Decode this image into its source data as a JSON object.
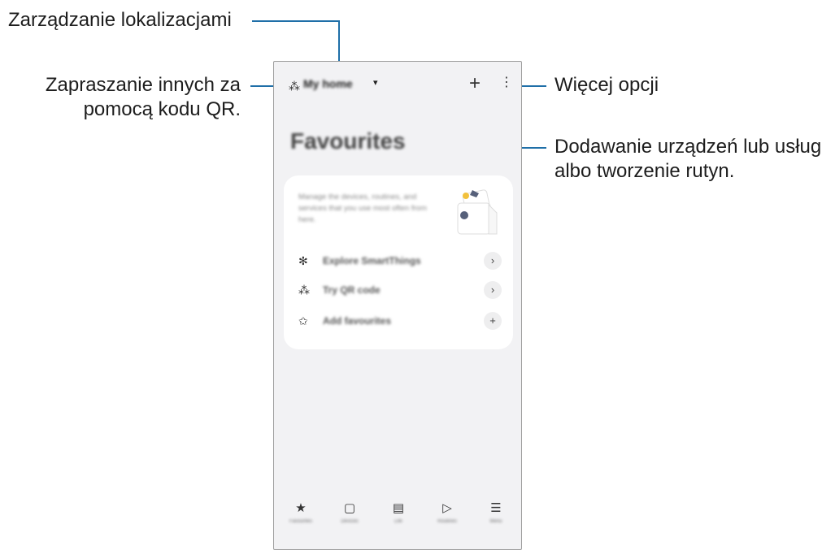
{
  "callouts": {
    "manage_locations": "Zarządzanie lokalizacjami",
    "invite_qr_line1": "Zapraszanie innych za",
    "invite_qr_line2": "pomocą kodu QR.",
    "more_options": "Więcej opcji",
    "add_devices_line1": "Dodawanie urządzeń lub usług",
    "add_devices_line2": "albo tworzenie rutyn."
  },
  "app": {
    "location_name": "My home",
    "add_label": "+",
    "more_label": "⋮",
    "page_title": "Favourites",
    "card": {
      "description": "Manage the devices, routines, and services that you use most often from here.",
      "items": [
        {
          "icon": "smartthings-icon",
          "glyph": "✻",
          "label": "Explore SmartThings",
          "action": "›"
        },
        {
          "icon": "qr-code-icon",
          "glyph": "⁂",
          "label": "Try QR code",
          "action": "›"
        },
        {
          "icon": "star-icon",
          "glyph": "✩",
          "label": "Add favourites",
          "action": "+"
        }
      ]
    },
    "nav": [
      {
        "icon": "star-icon",
        "glyph": "★",
        "label": "Favourites"
      },
      {
        "icon": "devices-icon",
        "glyph": "▢",
        "label": "Devices"
      },
      {
        "icon": "life-icon",
        "glyph": "▤",
        "label": "Life"
      },
      {
        "icon": "routines-icon",
        "glyph": "▷",
        "label": "Routines"
      },
      {
        "icon": "menu-icon",
        "glyph": "☰",
        "label": "Menu"
      }
    ]
  },
  "colors": {
    "callout_line": "#1f6fa8",
    "phone_bg": "#f2f2f4"
  }
}
